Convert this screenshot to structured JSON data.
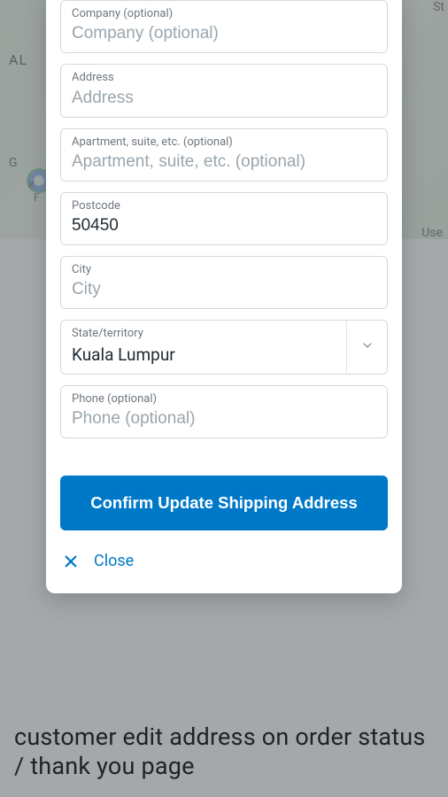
{
  "bg": {
    "al": "AL",
    "g": "G",
    "k": "K",
    "f": "F",
    "st": "St",
    "use": "Use"
  },
  "fields": {
    "company": {
      "label": "Company (optional)",
      "placeholder": "Company (optional)",
      "value": ""
    },
    "address": {
      "label": "Address",
      "placeholder": "Address",
      "value": ""
    },
    "apartment": {
      "label": "Apartment, suite, etc. (optional)",
      "placeholder": "Apartment, suite, etc. (optional)",
      "value": ""
    },
    "postcode": {
      "label": "Postcode",
      "placeholder": "Postcode",
      "value": "50450"
    },
    "city": {
      "label": "City",
      "placeholder": "City",
      "value": ""
    },
    "state": {
      "label": "State/territory",
      "value": "Kuala Lumpur"
    },
    "phone": {
      "label": "Phone (optional)",
      "placeholder": "Phone (optional)",
      "value": ""
    }
  },
  "buttons": {
    "confirm": "Confirm Update Shipping Address",
    "close": "Close"
  },
  "caption": "customer edit address on order status / thank you page"
}
